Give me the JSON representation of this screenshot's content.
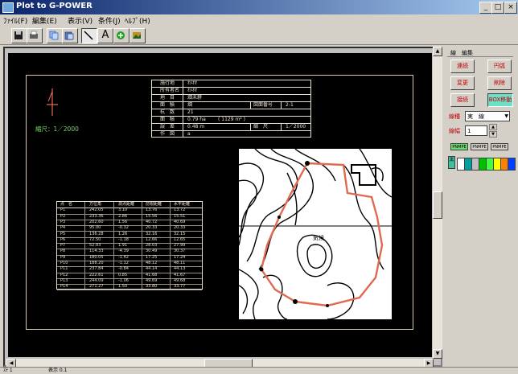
{
  "window": {
    "title": "Plot to G-POWER",
    "controls": {
      "minimize": "_",
      "maximize": "□",
      "close": "×"
    }
  },
  "menu": {
    "items": [
      "ﾌｧｲﾙ(F)",
      "編集(E)",
      "表示(V)",
      "条件(J)",
      "ﾍﾙﾌﾟ(H)"
    ]
  },
  "toolbar": {
    "tools": [
      "save-icon",
      "print-icon",
      "copy-icon",
      "paste-icon",
      "line-tool-icon",
      "text-tool-icon",
      "zoom-icon",
      "image-icon"
    ],
    "text_tool_label": "A"
  },
  "canvas": {
    "scale_text": "縮尺：1／2000",
    "info_table": {
      "rows": [
        {
          "label": "施行地",
          "value": "ｵﾒｵｵ"
        },
        {
          "label": "所有者名",
          "value": "ｵﾒｵｵ"
        },
        {
          "label": "地　目",
          "value": "畑未耕"
        },
        {
          "label": "面　積",
          "value": "畑",
          "extra_label": "図面番号",
          "extra_value": "2-1"
        },
        {
          "label": "杭　数",
          "value": "21"
        },
        {
          "label": "面　積",
          "value": "0.79 ha",
          "extra_value": "( 1129 m² )"
        },
        {
          "label": "誤　差",
          "value": "0.48 m",
          "extra_label": "縮　尺",
          "extra_value": "1／2000"
        },
        {
          "label": "作　図",
          "value": "a"
        }
      ]
    },
    "coord_table": {
      "headers": [
        "点　名",
        "方位角",
        "測点距離",
        "前視距離",
        "水平距離"
      ],
      "rows": [
        [
          "P1",
          "242.05",
          "3.10",
          "13.76",
          "13.72"
        ],
        [
          "P2",
          "233.36",
          "2.86",
          "15.56",
          "15.51"
        ],
        [
          "P3",
          "202.60",
          "1.56",
          "40.72",
          "40.69"
        ],
        [
          "P4",
          "95.00",
          "-0.32",
          "20.33",
          "20.33"
        ],
        [
          "P5",
          "136.28",
          "1.26",
          "32.16",
          "32.15"
        ],
        [
          "P6",
          "72.50",
          "-1.18",
          "12.66",
          "12.65"
        ],
        [
          "P7",
          "52.03",
          "1.91",
          "28.03",
          "27.99"
        ],
        [
          "P8",
          "114.33",
          "-4.39",
          "30.49",
          "30.37"
        ],
        [
          "P9",
          "180.05",
          "-1.42",
          "17.25",
          "17.24"
        ],
        [
          "P10",
          "188.20",
          "-1.12",
          "48.12",
          "48.11"
        ],
        [
          "P11",
          "237.84",
          "-0.84",
          "44.14",
          "44.13"
        ],
        [
          "P12",
          "222.61",
          "0.85",
          "41.68",
          "41.67"
        ],
        [
          "P13",
          "244.09",
          "-1.06",
          "49.69",
          "49.68"
        ],
        [
          "P14",
          "271.27",
          "1.50",
          "33.80",
          "33.77"
        ]
      ]
    },
    "map": {
      "annotation": "気候"
    }
  },
  "panel": {
    "title": "線　編集",
    "buttons": [
      {
        "label": "連続",
        "active": false
      },
      {
        "label": "円弧",
        "active": false
      },
      {
        "label": "変更",
        "active": false
      },
      {
        "label": "削除",
        "active": false
      },
      {
        "label": "接続",
        "active": false
      },
      {
        "label": "BOX移動",
        "active": true
      }
    ],
    "line_type_label": "線種",
    "line_type_value": "実　線",
    "line_width_label": "線幅",
    "line_width_value": "1",
    "small_buttons": [
      "PNMPE",
      "PNMPE",
      "PNMPE"
    ],
    "colors": [
      "#ffffff",
      "#00a0a0",
      "#c0c0c0",
      "#00c000",
      "#40ff40",
      "#ffff00",
      "#ff8000",
      "#0040ff"
    ],
    "color_label": "黒"
  },
  "status": {
    "left": "ｽﾃ 1 ",
    "right": "表示 0.1"
  }
}
